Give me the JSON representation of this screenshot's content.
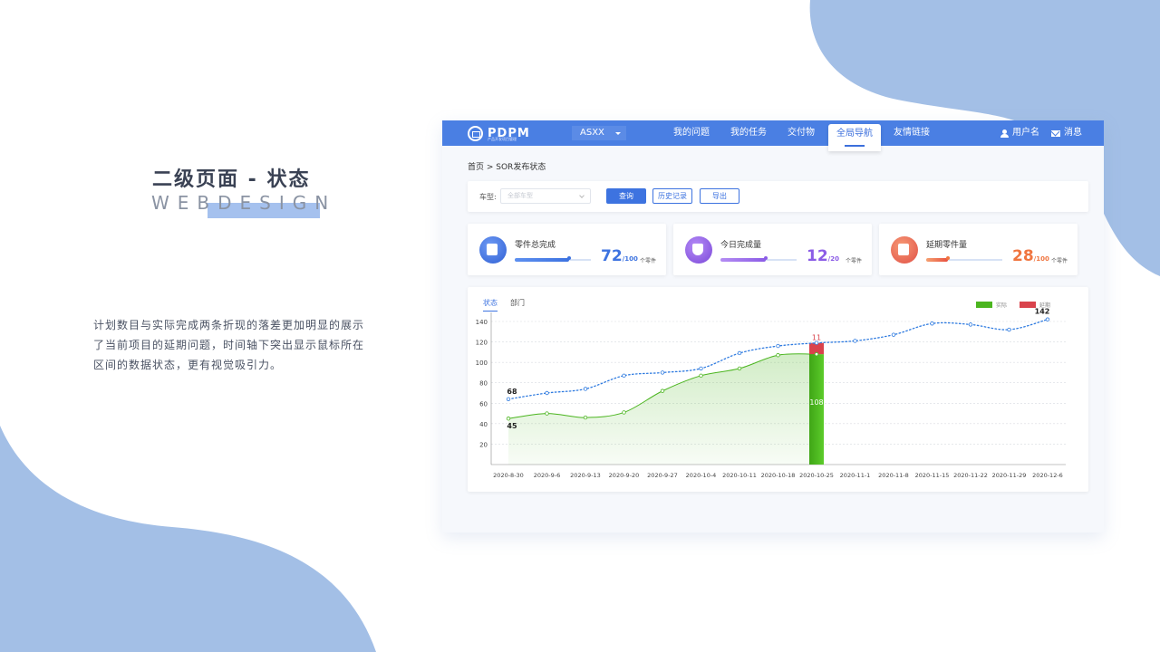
{
  "intro": {
    "title": "二级页面 - 状态",
    "subtitle": "WEBDESIGN",
    "description": "计划数目与实际完成两条折现的落差更加明显的展示了当前项目的延期问题，时间轴下突出显示鼠标所在区间的数据状态，更有视觉吸引力。"
  },
  "nav": {
    "logo_text": "PDPM",
    "logo_sub": "产品开发项目管理",
    "project_select": "ASXX",
    "items": [
      "我的问题",
      "我的任务",
      "交付物",
      "全局导航",
      "友情链接"
    ],
    "active_item": "全局导航",
    "user": "用户名",
    "messages": "消息"
  },
  "breadcrumb": "首页 > SOR发布状态",
  "filter": {
    "label": "车型:",
    "select_placeholder": "全部车型",
    "query_button": "查询",
    "history_button": "历史记录",
    "export_button": "导出"
  },
  "stats": [
    {
      "label": "零件总完成",
      "value": "72",
      "total": "/100",
      "unit": "个零件",
      "progress": 0.72,
      "color": "#3d73e0"
    },
    {
      "label": "今日完成量",
      "value": "12",
      "total": "/20",
      "unit": "个零件",
      "progress": 0.6,
      "color": "#8b5ce6"
    },
    {
      "label": "延期零件量",
      "value": "28",
      "total": "/100",
      "unit": "个零件",
      "progress": 0.28,
      "color": "#f0753f"
    }
  ],
  "chart": {
    "tabs": [
      "状态",
      "部门"
    ],
    "active_tab": "状态",
    "legend": [
      {
        "name": "实际",
        "color": "#4bb51f"
      },
      {
        "name": "延期",
        "color": "#d9434c"
      }
    ]
  },
  "chart_data": {
    "type": "line",
    "x": [
      "2020-8-30",
      "2020-9-6",
      "2020-9-13",
      "2020-9-20",
      "2020-9-27",
      "2020-10-4",
      "2020-10-11",
      "2020-10-18",
      "2020-10-25",
      "2020-11-1",
      "2020-11-8",
      "2020-11-15",
      "2020-11-22",
      "2020-11-29",
      "2020-12-6"
    ],
    "ylim": [
      0,
      140
    ],
    "yticks": [
      20,
      40,
      60,
      80,
      100,
      120,
      140
    ],
    "grid": true,
    "series": [
      {
        "name": "plan",
        "style": "dotted",
        "color": "#2f7be0",
        "values": [
          64,
          70,
          74,
          87,
          90,
          94,
          109,
          116,
          119,
          121,
          127,
          138,
          137,
          132,
          142
        ]
      },
      {
        "name": "实际",
        "style": "solid-area",
        "color": "#4bb51f",
        "values": [
          45,
          50,
          46,
          51,
          72,
          87,
          94,
          107,
          108
        ]
      }
    ],
    "highlight": {
      "x": "2020-10-25",
      "actual": 108,
      "delay": 11
    },
    "point_labels": [
      {
        "x": "2020-8-30",
        "series": "plan",
        "text": "68"
      },
      {
        "x": "2020-8-30",
        "series": "实际",
        "text": "45"
      },
      {
        "x": "2020-12-6",
        "series": "plan",
        "text": "142"
      }
    ]
  }
}
